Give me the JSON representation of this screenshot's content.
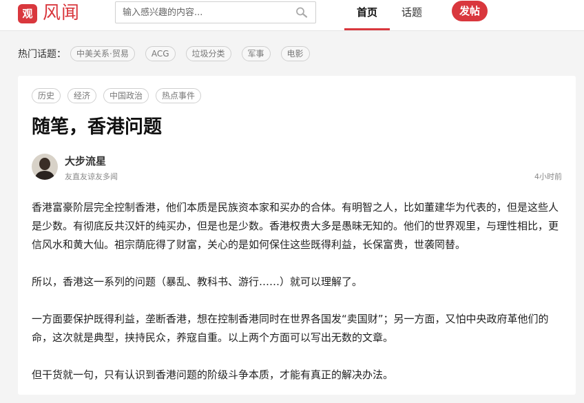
{
  "header": {
    "logo_glyph": "观",
    "logo_text": "风闻",
    "search_placeholder": "输入感兴趣的内容...",
    "nav": [
      "首页",
      "话题"
    ],
    "post_button": "发帖"
  },
  "hot_topics": {
    "label": "热门话题：",
    "items": [
      "中美关系·贸易",
      "ACG",
      "垃圾分类",
      "军事",
      "电影"
    ]
  },
  "article": {
    "tags": [
      "历史",
      "经济",
      "中国政治",
      "热点事件"
    ],
    "title": "随笔，香港问题",
    "author": {
      "name": "大步流星",
      "desc": "友直友谅友多闻"
    },
    "time": "4小时前",
    "paragraphs": [
      "香港富豪阶层完全控制香港，他们本质是民族资本家和买办的合体。有明智之人，比如董建华为代表的，但是这些人是少数。有彻底反共汉奸的纯买办，但是也是少数。香港权贵大多是愚昧无知的。他们的世界观里，与理性相比，更信风水和黄大仙。祖宗荫庇得了财富，关心的是如何保住这些既得利益，长保富贵，世袭罔替。",
      "所以，香港这一系列的问题（暴乱、教科书、游行……）就可以理解了。",
      "一方面要保护既得利益，垄断香港，想在控制香港同时在世界各国发“卖国财”；另一方面，又怕中央政府革他们的命，这次就是典型，挟持民众，养寇自重。以上两个方面可以写出无数的文章。",
      "但干货就一句，只有认识到香港问题的阶级斗争本质，才能有真正的解决办法。"
    ]
  },
  "colors": {
    "brand": "#d9373d"
  }
}
